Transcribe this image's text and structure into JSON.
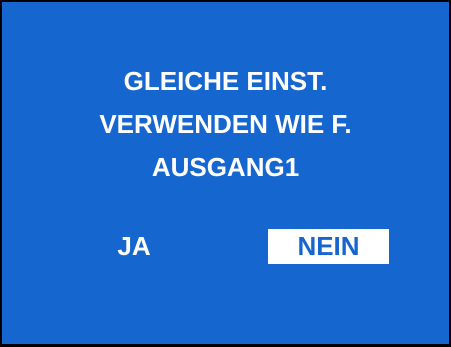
{
  "dialog": {
    "message_lines": [
      "GLEICHE EINST.",
      "VERWENDEN WIE F.",
      "AUSGANG1"
    ],
    "options": {
      "yes_label": "JA",
      "no_label": "NEIN",
      "selected": "NEIN"
    }
  },
  "colors": {
    "background": "#1666cf",
    "text": "#ffffff",
    "selected_background": "#ffffff",
    "selected_text": "#1666cf",
    "border": "#000000"
  }
}
